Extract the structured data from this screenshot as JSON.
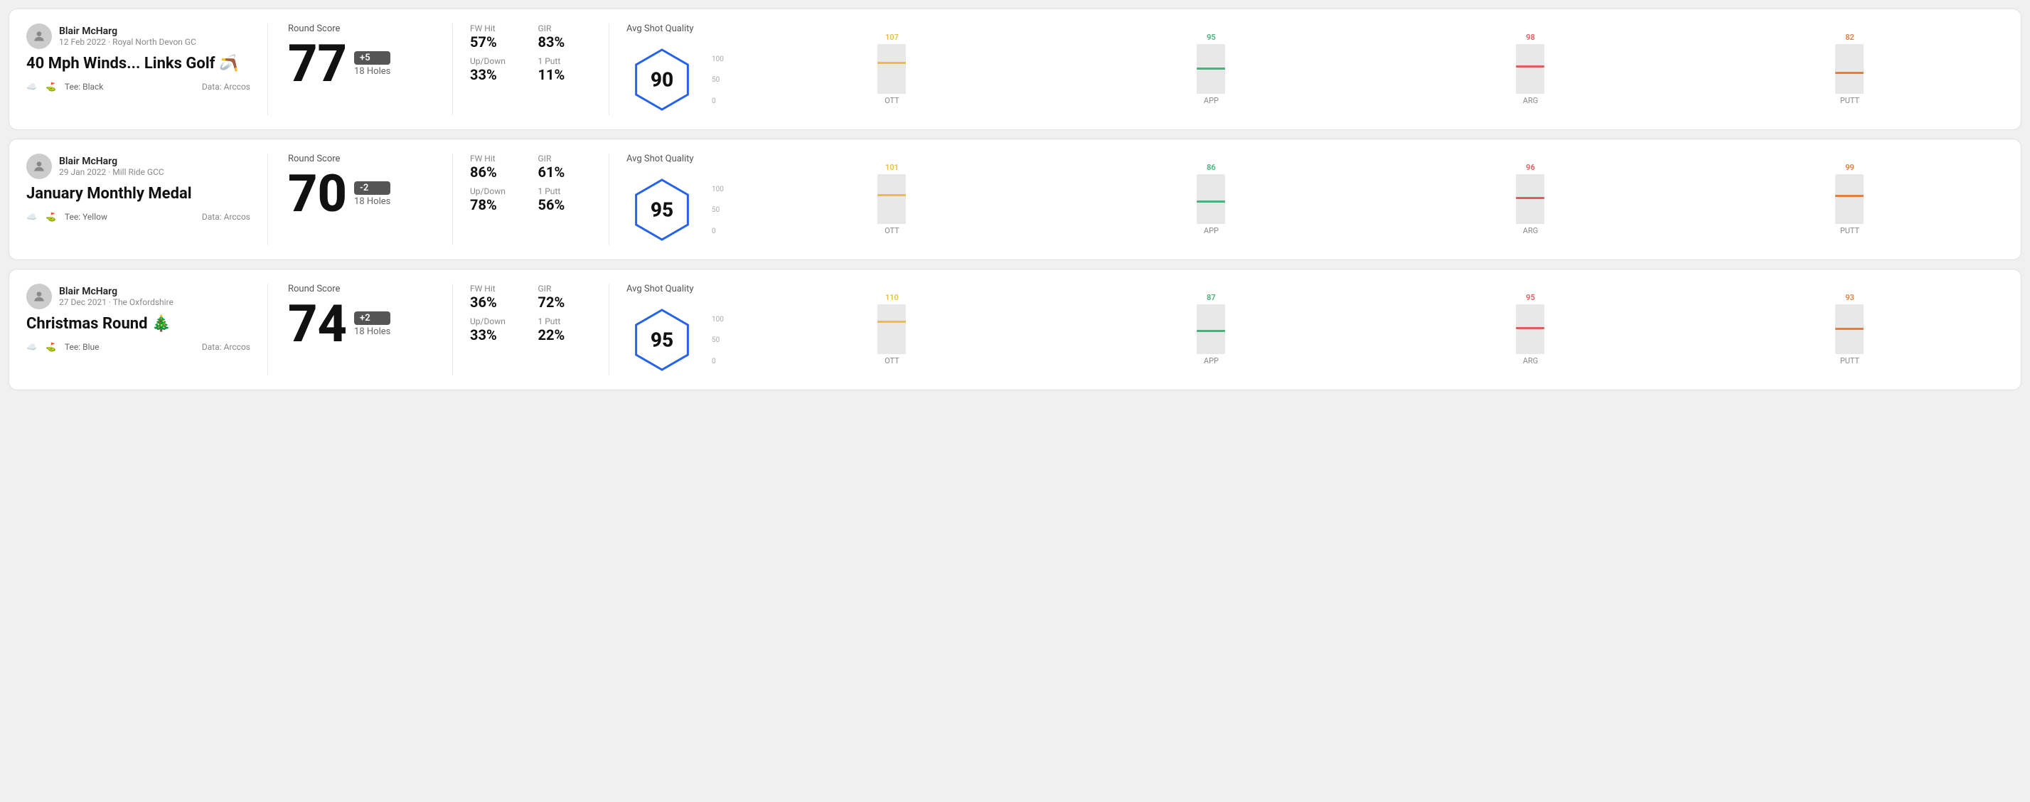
{
  "rounds": [
    {
      "id": "round-1",
      "user_name": "Blair McHarg",
      "date": "12 Feb 2022 · Royal North Devon GC",
      "title": "40 Mph Winds... Links Golf 🪃",
      "tee": "Black",
      "data_source": "Data: Arccos",
      "round_score_label": "Round Score",
      "score": "77",
      "score_diff": "+5",
      "holes": "18 Holes",
      "fw_hit_label": "FW Hit",
      "fw_hit": "57%",
      "gir_label": "GIR",
      "gir": "83%",
      "updown_label": "Up/Down",
      "updown": "33%",
      "oneputt_label": "1 Putt",
      "oneputt": "11%",
      "avg_quality_label": "Avg Shot Quality",
      "quality_score": "90",
      "bars": [
        {
          "label": "OTT",
          "value": 107,
          "color": "#e6c040",
          "fill_pct": 60
        },
        {
          "label": "APP",
          "value": 95,
          "color": "#4caf7d",
          "fill_pct": 48
        },
        {
          "label": "ARG",
          "value": 98,
          "color": "#e05c5c",
          "fill_pct": 52
        },
        {
          "label": "PUTT",
          "value": 82,
          "color": "#e08040",
          "fill_pct": 40
        }
      ]
    },
    {
      "id": "round-2",
      "user_name": "Blair McHarg",
      "date": "29 Jan 2022 · Mill Ride GCC",
      "title": "January Monthly Medal",
      "tee": "Yellow",
      "data_source": "Data: Arccos",
      "round_score_label": "Round Score",
      "score": "70",
      "score_diff": "-2",
      "holes": "18 Holes",
      "fw_hit_label": "FW Hit",
      "fw_hit": "86%",
      "gir_label": "GIR",
      "gir": "61%",
      "updown_label": "Up/Down",
      "updown": "78%",
      "oneputt_label": "1 Putt",
      "oneputt": "56%",
      "avg_quality_label": "Avg Shot Quality",
      "quality_score": "95",
      "bars": [
        {
          "label": "OTT",
          "value": 101,
          "color": "#e6c040",
          "fill_pct": 55
        },
        {
          "label": "APP",
          "value": 86,
          "color": "#4caf7d",
          "fill_pct": 42
        },
        {
          "label": "ARG",
          "value": 96,
          "color": "#e05c5c",
          "fill_pct": 50
        },
        {
          "label": "PUTT",
          "value": 99,
          "color": "#e08040",
          "fill_pct": 53
        }
      ]
    },
    {
      "id": "round-3",
      "user_name": "Blair McHarg",
      "date": "27 Dec 2021 · The Oxfordshire",
      "title": "Christmas Round 🎄",
      "tee": "Blue",
      "data_source": "Data: Arccos",
      "round_score_label": "Round Score",
      "score": "74",
      "score_diff": "+2",
      "holes": "18 Holes",
      "fw_hit_label": "FW Hit",
      "fw_hit": "36%",
      "gir_label": "GIR",
      "gir": "72%",
      "updown_label": "Up/Down",
      "updown": "33%",
      "oneputt_label": "1 Putt",
      "oneputt": "22%",
      "avg_quality_label": "Avg Shot Quality",
      "quality_score": "95",
      "bars": [
        {
          "label": "OTT",
          "value": 110,
          "color": "#e6c040",
          "fill_pct": 62
        },
        {
          "label": "APP",
          "value": 87,
          "color": "#4caf7d",
          "fill_pct": 43
        },
        {
          "label": "ARG",
          "value": 95,
          "color": "#e05c5c",
          "fill_pct": 50
        },
        {
          "label": "PUTT",
          "value": 93,
          "color": "#e08040",
          "fill_pct": 48
        }
      ]
    }
  ]
}
